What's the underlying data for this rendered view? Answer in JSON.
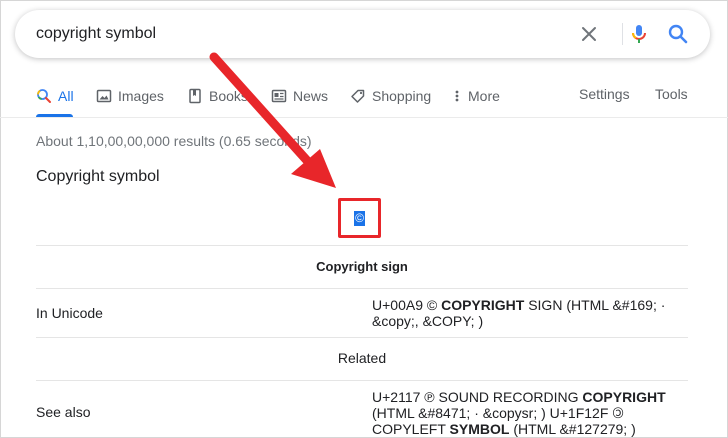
{
  "search": {
    "query": "copyright symbol",
    "icons": [
      "close-icon",
      "microphone-icon",
      "search-icon"
    ]
  },
  "tabs": [
    {
      "label": "All",
      "icon": "search-icon",
      "active": true
    },
    {
      "label": "Images",
      "icon": "image-icon"
    },
    {
      "label": "Books",
      "icon": "book-icon"
    },
    {
      "label": "News",
      "icon": "news-icon"
    },
    {
      "label": "Shopping",
      "icon": "tag-icon"
    },
    {
      "label": "More",
      "icon": "more-vert-icon"
    }
  ],
  "tools": {
    "settings": "Settings",
    "tools": "Tools"
  },
  "result_stats": "About 1,10,00,00,000 results (0.65 seconds)",
  "panel": {
    "title": "Copyright symbol",
    "symbol": "©",
    "caption": "Copyright sign",
    "related_label": "Related",
    "rows": {
      "unicode": {
        "label": "In Unicode",
        "value_parts": [
          "U+00A9 © ",
          "COPYRIGHT",
          " SIGN (HTML &#169; · &copy;, &COPY; )"
        ]
      },
      "see_also": {
        "label": "See also",
        "value_parts": [
          "U+2117 ℗ SOUND RECORDING ",
          "COPYRIGHT",
          " (HTML &#8471; · &copysr; ) U+1F12F 🄯 COPYLEFT ",
          "SYMBOL",
          " (HTML &#127279; )"
        ]
      }
    }
  },
  "colors": {
    "accent": "#1a73e8",
    "annotation": "#e8262a",
    "text": "#202124",
    "muted": "#5f6368"
  }
}
